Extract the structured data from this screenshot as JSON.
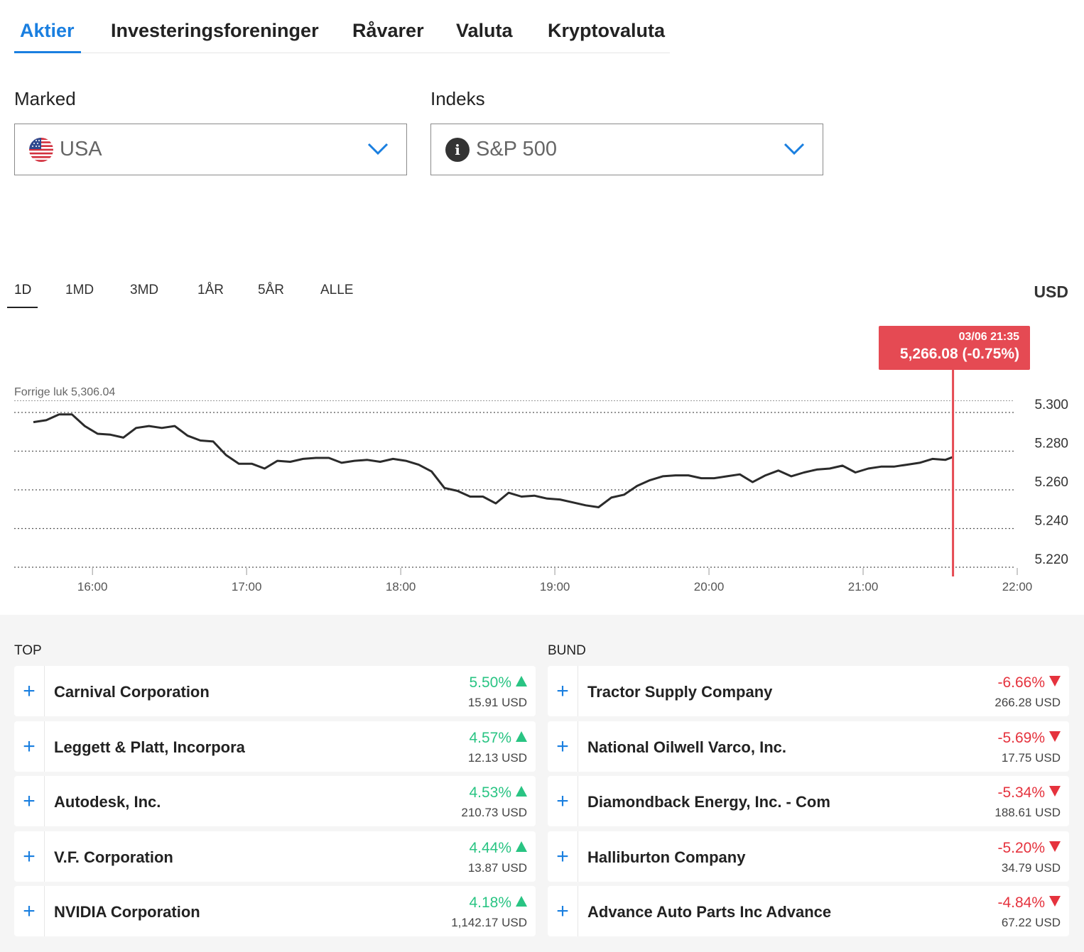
{
  "tabs": [
    "Aktier",
    "Investeringsforeninger",
    "Råvarer",
    "Valuta",
    "Kryptovaluta"
  ],
  "market": {
    "label": "Marked",
    "value": "USA",
    "icon": "us-flag-icon"
  },
  "index": {
    "label": "Indeks",
    "value": "S&P 500",
    "icon": "info-icon"
  },
  "ranges": [
    "1D",
    "1MD",
    "3MD",
    "1ÅR",
    "5ÅR",
    "ALLE"
  ],
  "active_range": "1D",
  "currency": "USD",
  "tooltip": {
    "datetime": "03/06 21:35",
    "value": "5,266.08 (-0.75%)"
  },
  "colors": {
    "accent": "#1a7fe0",
    "up": "#29c483",
    "down": "#e5323d",
    "marker": "#e54a53"
  },
  "chart_data": {
    "type": "line",
    "prev_close_label": "Forrige luk 5,306.04",
    "prev_close": 5306.04,
    "y_ticks": [
      "5.300",
      "5.280",
      "5.260",
      "5.240",
      "5.220"
    ],
    "ylim": [
      5220,
      5300
    ],
    "x_ticks": [
      "16:00",
      "17:00",
      "18:00",
      "19:00",
      "20:00",
      "21:00",
      "22:00"
    ],
    "xlim": [
      "15:37",
      "22:00"
    ],
    "marker_time": "21:35",
    "grid": true,
    "x": [
      "15:37",
      "15:42",
      "15:47",
      "15:52",
      "15:57",
      "16:02",
      "16:07",
      "16:12",
      "16:17",
      "16:22",
      "16:27",
      "16:32",
      "16:37",
      "16:42",
      "16:47",
      "16:52",
      "16:57",
      "17:02",
      "17:07",
      "17:12",
      "17:17",
      "17:22",
      "17:27",
      "17:32",
      "17:37",
      "17:42",
      "17:47",
      "17:52",
      "17:57",
      "18:02",
      "18:07",
      "18:12",
      "18:17",
      "18:22",
      "18:27",
      "18:32",
      "18:37",
      "18:42",
      "18:47",
      "18:52",
      "18:57",
      "19:02",
      "19:07",
      "19:12",
      "19:17",
      "19:22",
      "19:27",
      "19:32",
      "19:37",
      "19:42",
      "19:47",
      "19:52",
      "19:57",
      "20:02",
      "20:07",
      "20:12",
      "20:17",
      "20:22",
      "20:27",
      "20:32",
      "20:37",
      "20:42",
      "20:47",
      "20:52",
      "20:57",
      "21:02",
      "21:07",
      "21:12",
      "21:17",
      "21:22",
      "21:27",
      "21:32",
      "21:35"
    ],
    "values": [
      5295,
      5296,
      5299,
      5299,
      5293,
      5289,
      5288.5,
      5287,
      5292,
      5293,
      5292,
      5293,
      5288,
      5285.5,
      5285,
      5278,
      5273.5,
      5273.5,
      5271,
      5275,
      5274.5,
      5276,
      5276.5,
      5276.5,
      5274,
      5275,
      5275.5,
      5274.5,
      5276,
      5275,
      5273,
      5269.5,
      5261,
      5259.5,
      5256.5,
      5256.5,
      5253,
      5258.5,
      5256.5,
      5257,
      5255.5,
      5255,
      5253.5,
      5252,
      5251,
      5256,
      5257.5,
      5262,
      5265,
      5267,
      5267.5,
      5267.5,
      5266,
      5266,
      5267,
      5268,
      5264,
      5267.5,
      5270,
      5267,
      5269,
      5270.5,
      5271,
      5272.5,
      5269,
      5271,
      5272,
      5272,
      5273,
      5274,
      5276,
      5275.5,
      5277,
      5272
    ]
  },
  "top": {
    "title": "TOP",
    "items": [
      {
        "name": "Carnival Corporation",
        "change": "5.50%",
        "price": "15.91 USD"
      },
      {
        "name": "Leggett & Platt, Incorpora",
        "change": "4.57%",
        "price": "12.13 USD"
      },
      {
        "name": "Autodesk, Inc.",
        "change": "4.53%",
        "price": "210.73 USD"
      },
      {
        "name": "V.F. Corporation",
        "change": "4.44%",
        "price": "13.87 USD"
      },
      {
        "name": "NVIDIA Corporation",
        "change": "4.18%",
        "price": "1,142.17 USD"
      }
    ]
  },
  "bottom": {
    "title": "BUND",
    "items": [
      {
        "name": "Tractor Supply Company",
        "change": "-6.66%",
        "price": "266.28 USD"
      },
      {
        "name": "National Oilwell Varco, Inc.",
        "change": "-5.69%",
        "price": "17.75 USD"
      },
      {
        "name": "Diamondback Energy, Inc. - Com",
        "change": "-5.34%",
        "price": "188.61 USD"
      },
      {
        "name": "Halliburton Company",
        "change": "-5.20%",
        "price": "34.79 USD"
      },
      {
        "name": "Advance Auto Parts Inc Advance",
        "change": "-4.84%",
        "price": "67.22 USD"
      }
    ]
  }
}
